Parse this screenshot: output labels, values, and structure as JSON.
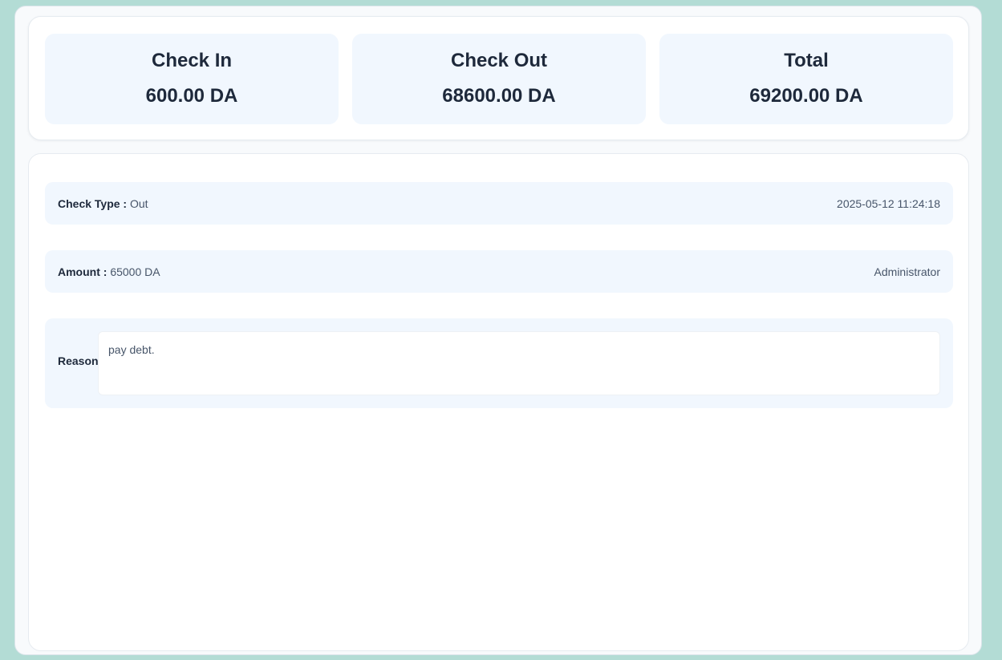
{
  "summary": {
    "check_in": {
      "label": "Check In",
      "value": "600.00 DA"
    },
    "check_out": {
      "label": "Check Out",
      "value": "68600.00 DA"
    },
    "total": {
      "label": "Total",
      "value": "69200.00 DA"
    }
  },
  "detail": {
    "check_type": {
      "label": "Check Type :",
      "value": "Out"
    },
    "datetime": "2025-05-12 11:24:18",
    "amount": {
      "label": "Amount :",
      "value": "65000 DA"
    },
    "user": "Administrator",
    "reason": {
      "label": "Reason",
      "value": "pay debt."
    }
  },
  "colors": {
    "background": "#b3dcd5",
    "card": "#ffffff",
    "tile": "#f1f7fe",
    "text": "#1e293b",
    "muted": "#475569"
  }
}
